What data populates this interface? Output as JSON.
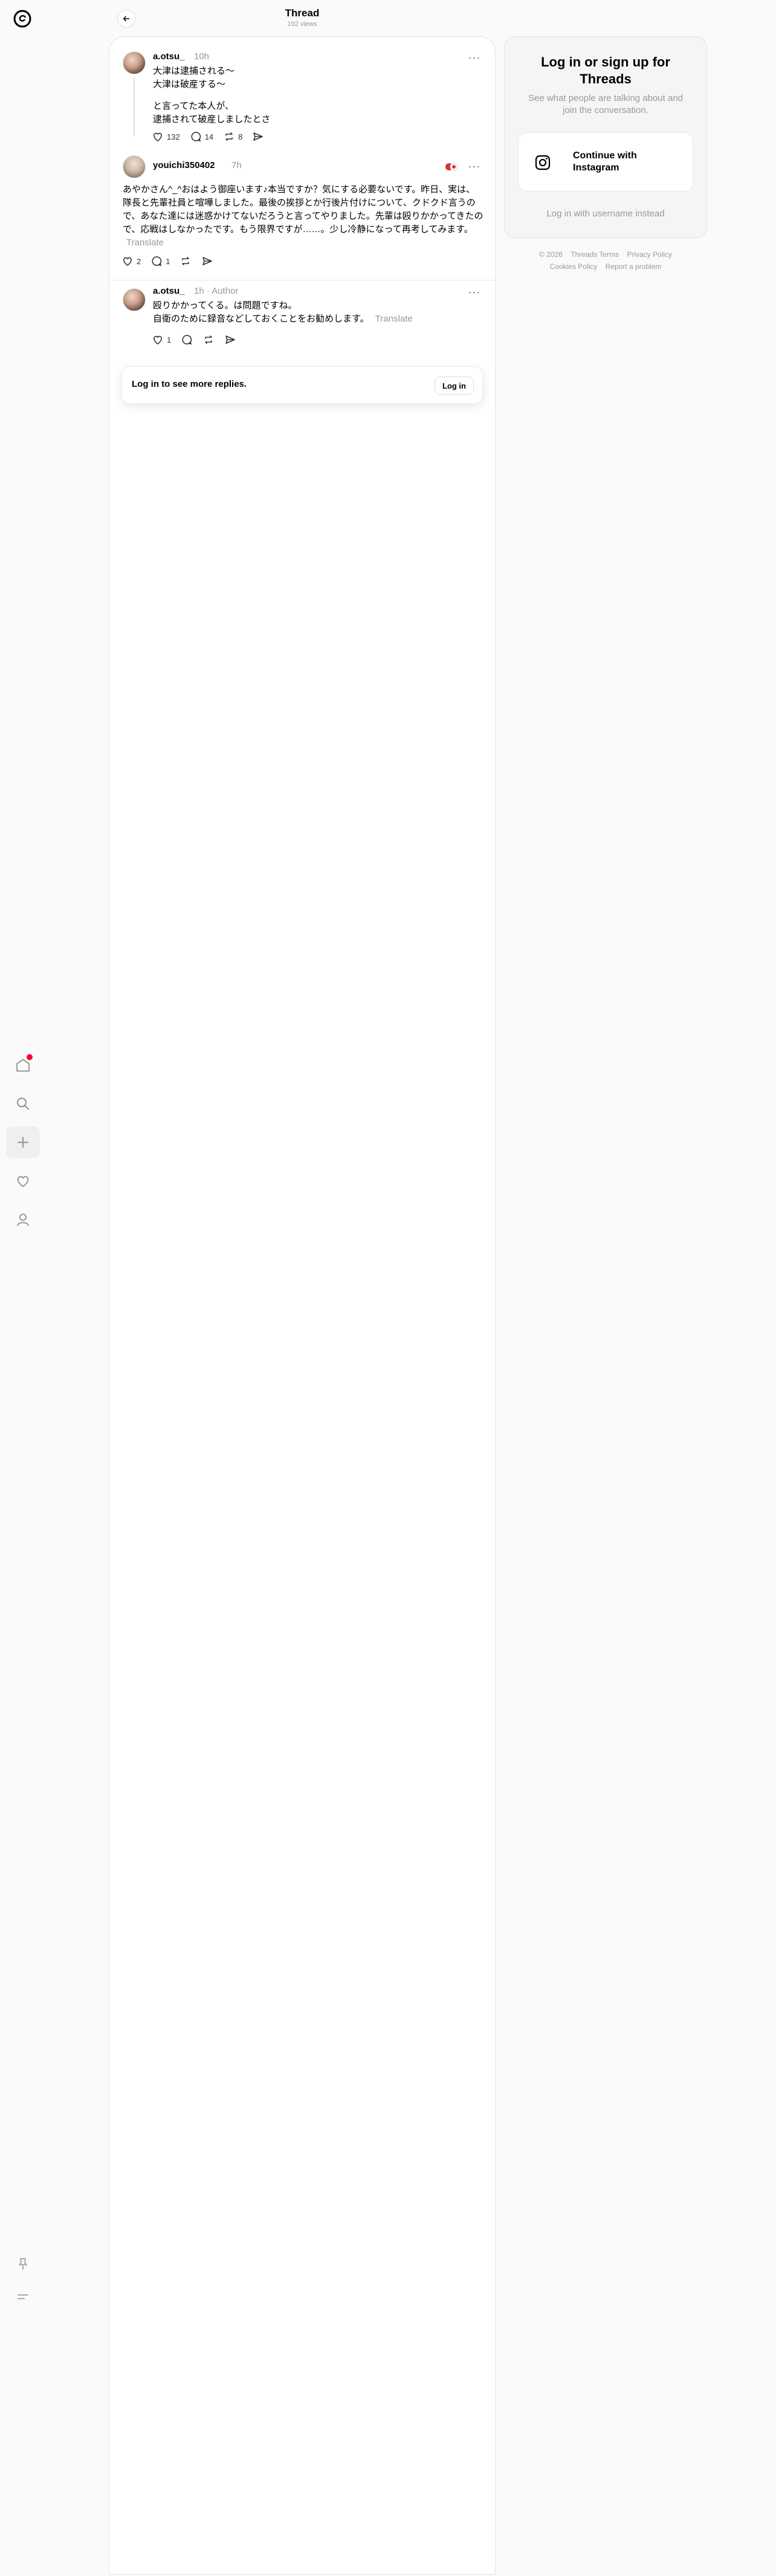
{
  "header": {
    "title": "Thread",
    "views": "192 views"
  },
  "rail": {
    "items": [
      "home-icon",
      "search-icon",
      "create-icon",
      "activity-icon",
      "profile-icon",
      "pin-icon",
      "menu-icon"
    ]
  },
  "posts": [
    {
      "username": "a.otsu_",
      "time": "10h",
      "lines": [
        "大津は逮捕される〜",
        "大津は破産する〜",
        "",
        "と言ってた本人が、",
        "逮捕されて破産しましたとさ"
      ],
      "likes": "132",
      "replies": "14",
      "reposts": "8"
    },
    {
      "username": "youichi350402",
      "time": "7h",
      "text": "あやかさん^_^おはよう御座います♪本当ですか？気にする必要ないです。昨日、実は、隊長と先輩社員と喧嘩しました。最後の挨拶とか行後片付けについて、クドクド言うので、あなた達には迷惑かけてないだろうと言ってやりました。先輩は殴りかかってきたので、応戦はしなかったです。もう限界ですが……。少し冷静になって再考してみます。",
      "translate": "Translate",
      "likes": "2",
      "replies": "1"
    },
    {
      "username": "a.otsu_",
      "time": "1h",
      "author_label": "Author",
      "lines": [
        "殴りかかってくる。は問題ですね。",
        "自衛のために録音などしておくことをお勧めします。"
      ],
      "translate": "Translate",
      "likes": "1"
    }
  ],
  "login_bar": {
    "text": "Log in to see more replies.",
    "button": "Log in"
  },
  "panel": {
    "title": "Log in or sign up for Threads",
    "subtitle": "See what people are talking about and join the conversation.",
    "instagram_button": "Continue with Instagram",
    "alt_login": "Log in with username instead"
  },
  "footer": {
    "row1": [
      "© 2026",
      "Threads Terms",
      "Privacy Policy"
    ],
    "row2": [
      "Cookies Policy",
      "Report a problem"
    ]
  }
}
